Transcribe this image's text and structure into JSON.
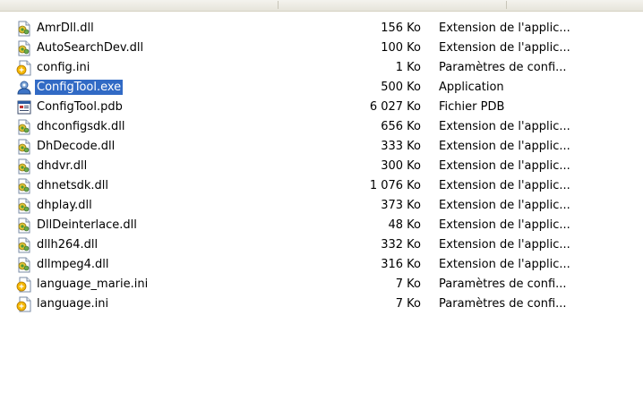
{
  "files": [
    {
      "name": "AmrDll.dll",
      "size": "156 Ko",
      "type": "Extension de l'applic...",
      "icon": "dll-file-icon",
      "selected": false
    },
    {
      "name": "AutoSearchDev.dll",
      "size": "100 Ko",
      "type": "Extension de l'applic...",
      "icon": "dll-file-icon",
      "selected": false
    },
    {
      "name": "config.ini",
      "size": "1 Ko",
      "type": "Paramètres de confi...",
      "icon": "ini-file-icon",
      "selected": false
    },
    {
      "name": "ConfigTool.exe",
      "size": "500 Ko",
      "type": "Application",
      "icon": "exe-file-icon",
      "selected": true
    },
    {
      "name": "ConfigTool.pdb",
      "size": "6 027 Ko",
      "type": "Fichier PDB",
      "icon": "pdb-file-icon",
      "selected": false
    },
    {
      "name": "dhconfigsdk.dll",
      "size": "656 Ko",
      "type": "Extension de l'applic...",
      "icon": "dll-file-icon",
      "selected": false
    },
    {
      "name": "DhDecode.dll",
      "size": "333 Ko",
      "type": "Extension de l'applic...",
      "icon": "dll-file-icon",
      "selected": false
    },
    {
      "name": "dhdvr.dll",
      "size": "300 Ko",
      "type": "Extension de l'applic...",
      "icon": "dll-file-icon",
      "selected": false
    },
    {
      "name": "dhnetsdk.dll",
      "size": "1 076 Ko",
      "type": "Extension de l'applic...",
      "icon": "dll-file-icon",
      "selected": false
    },
    {
      "name": "dhplay.dll",
      "size": "373 Ko",
      "type": "Extension de l'applic...",
      "icon": "dll-file-icon",
      "selected": false
    },
    {
      "name": "DllDeinterlace.dll",
      "size": "48 Ko",
      "type": "Extension de l'applic...",
      "icon": "dll-file-icon",
      "selected": false
    },
    {
      "name": "dllh264.dll",
      "size": "332 Ko",
      "type": "Extension de l'applic...",
      "icon": "dll-file-icon",
      "selected": false
    },
    {
      "name": "dllmpeg4.dll",
      "size": "316 Ko",
      "type": "Extension de l'applic...",
      "icon": "dll-file-icon",
      "selected": false
    },
    {
      "name": "language_marie.ini",
      "size": "7 Ko",
      "type": "Paramètres de confi...",
      "icon": "ini-file-icon",
      "selected": false
    },
    {
      "name": "language.ini",
      "size": "7 Ko",
      "type": "Paramètres de confi...",
      "icon": "ini-file-icon",
      "selected": false
    }
  ],
  "colors": {
    "selection": "#316ac5",
    "selection_text": "#ffffff"
  }
}
